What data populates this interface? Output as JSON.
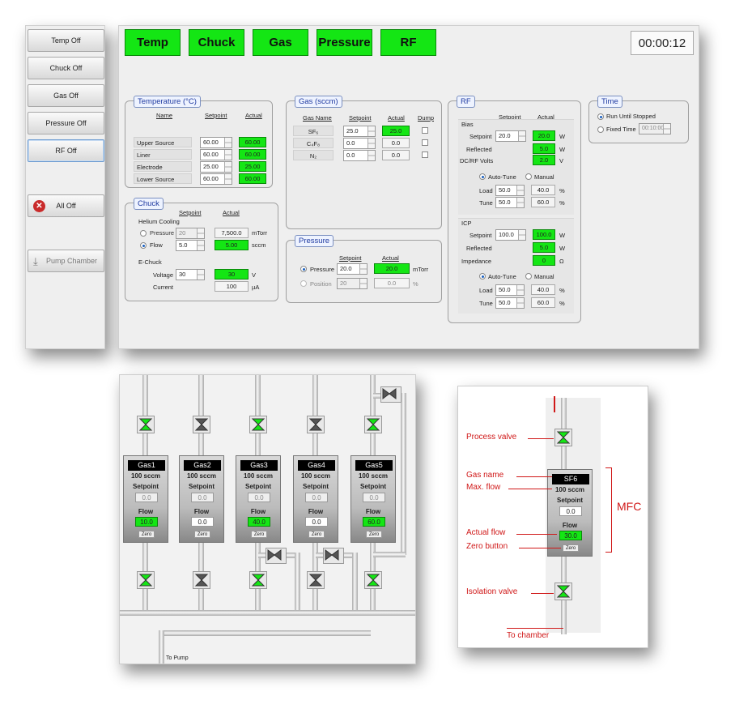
{
  "sidebar": {
    "buttons": [
      "Temp Off",
      "Chuck Off",
      "Gas Off",
      "Pressure Off",
      "RF Off"
    ],
    "all_off": "All Off",
    "pump": "Pump Chamber"
  },
  "tabs": [
    "Temp",
    "Chuck",
    "Gas",
    "Pressure",
    "RF"
  ],
  "clock": "00:00:12",
  "temperature": {
    "title": "Temperature (°C)",
    "h_name": "Name",
    "h_setpoint": "Setpoint",
    "h_actual": "Actual",
    "rows": [
      {
        "name": "Upper Source",
        "sp": "60.00",
        "ac": "60.00"
      },
      {
        "name": "Liner",
        "sp": "60.00",
        "ac": "60.00"
      },
      {
        "name": "Electrode",
        "sp": "25.00",
        "ac": "25.00"
      },
      {
        "name": "Lower Source",
        "sp": "60.00",
        "ac": "60.00"
      }
    ]
  },
  "chuck": {
    "title": "Chuck",
    "h_setpoint": "Setpoint",
    "h_actual": "Actual",
    "helium": "Helium Cooling",
    "pressure": {
      "label": "Pressure",
      "sp": "20",
      "ac": "7,500.0",
      "unit": "mTorr"
    },
    "flow": {
      "label": "Flow",
      "sp": "5.0",
      "ac": "5.00",
      "unit": "sccm"
    },
    "echuck": "E-Chuck",
    "voltage": {
      "label": "Voltage",
      "sp": "30",
      "ac": "30",
      "unit": "V"
    },
    "current": {
      "label": "Current",
      "ac": "100",
      "unit": "µA"
    }
  },
  "gas": {
    "title": "Gas (sccm)",
    "h_name": "Gas Name",
    "h_setpoint": "Setpoint",
    "h_actual": "Actual",
    "h_dump": "Dump",
    "rows": [
      {
        "name": "SF₆",
        "sp": "25.0",
        "ac": "25.0"
      },
      {
        "name": "C₄F₈",
        "sp": "0.0",
        "ac": "0.0"
      },
      {
        "name": "N₂",
        "sp": "0.0",
        "ac": "0.0"
      }
    ]
  },
  "pressure": {
    "title": "Pressure",
    "h_setpoint": "Setpoint",
    "h_actual": "Actual",
    "pressure": {
      "label": "Pressure",
      "sp": "20.0",
      "ac": "20.0",
      "unit": "mTorr"
    },
    "position": {
      "label": "Position",
      "sp": "20",
      "ac": "0.0",
      "unit": "%"
    }
  },
  "rf": {
    "title": "RF",
    "h_setpoint": "Setpoint",
    "h_actual": "Actual",
    "bias": {
      "title": "Bias",
      "setpoint": "Setpoint",
      "sp": "20.0",
      "ac": "20.0",
      "reflected": "Reflected",
      "refl": "5.0",
      "dcrf": "DC/RF Volts",
      "dc": "2.0",
      "u_w": "W",
      "u_v": "V",
      "auto": "Auto-Tune",
      "manual": "Manual",
      "load": "Load",
      "load_sp": "50.0",
      "load_ac": "40.0",
      "tune": "Tune",
      "tune_sp": "50.0",
      "tune_ac": "60.0",
      "pct": "%"
    },
    "icp": {
      "title": "ICP",
      "setpoint": "Setpoint",
      "sp": "100.0",
      "ac": "100.0",
      "reflected": "Reflected",
      "refl": "5.0",
      "impedance": "Impedance",
      "imp": "0",
      "u_w": "W",
      "u_o": "Ω",
      "auto": "Auto-Tune",
      "manual": "Manual",
      "load": "Load",
      "load_sp": "50.0",
      "load_ac": "40.0",
      "tune": "Tune",
      "tune_sp": "50.0",
      "tune_ac": "60.0",
      "pct": "%"
    }
  },
  "time": {
    "title": "Time",
    "run": "Run Until Stopped",
    "fixed": "Fixed Time",
    "fixed_val": "00:10:00"
  },
  "mfcs": [
    {
      "name": "Gas1",
      "max": "100 sccm",
      "sp": "0.0",
      "flow": "10.0",
      "green": true
    },
    {
      "name": "Gas2",
      "max": "100 sccm",
      "sp": "0.0",
      "flow": "0.0",
      "green": false
    },
    {
      "name": "Gas3",
      "max": "100 sccm",
      "sp": "0.0",
      "flow": "40.0",
      "green": true
    },
    {
      "name": "Gas4",
      "max": "100 sccm",
      "sp": "0.0",
      "flow": "0.0",
      "green": false
    },
    {
      "name": "Gas5",
      "max": "100 sccm",
      "sp": "0.0",
      "flow": "60.0",
      "green": true
    }
  ],
  "mfc_labels": {
    "setpoint": "Setpoint",
    "flow": "Flow",
    "zero": "Zero"
  },
  "to_pump": "To Pump",
  "inset": {
    "process_valve": "Process valve",
    "gas_name": "Gas name",
    "max_flow": "Max. flow",
    "actual_flow": "Actual flow",
    "zero_button": "Zero button",
    "isolation_valve": "Isolation valve",
    "to_chamber": "To chamber",
    "mfc": "MFC",
    "mfc_name": "SF6",
    "mfc_max": "100 sccm",
    "mfc_setpoint": "Setpoint",
    "mfc_sp": "0.0",
    "mfc_flow_label": "Flow",
    "mfc_flow": "30.0",
    "mfc_zero": "Zero"
  },
  "colors": {
    "green": "#14e614",
    "accent": "#1f3aa0",
    "red": "#d01818"
  }
}
